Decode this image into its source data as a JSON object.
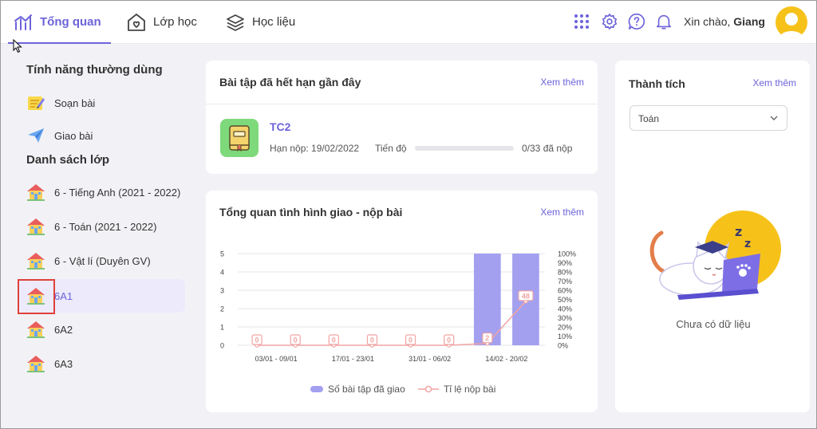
{
  "nav": {
    "tabs": [
      {
        "label": "Tổng quan",
        "icon": "chart-icon"
      },
      {
        "label": "Lớp học",
        "icon": "house-heart-icon"
      },
      {
        "label": "Học liệu",
        "icon": "layers-icon"
      }
    ],
    "greeting_prefix": "Xin chào, ",
    "greeting_name": "Giang"
  },
  "sidebar": {
    "features_heading": "Tính năng thường dùng",
    "features": [
      {
        "label": "Soạn bài",
        "icon": "notepad-icon"
      },
      {
        "label": "Giao bài",
        "icon": "paper-plane-icon"
      }
    ],
    "classes_heading": "Danh sách lớp",
    "classes": [
      {
        "label": "6 - Tiếng Anh (2021 - 2022)"
      },
      {
        "label": "6 - Toán (2021 - 2022)"
      },
      {
        "label": "6 - Vật lí (Duyên GV)"
      },
      {
        "label": "6A1",
        "active": true
      },
      {
        "label": "6A2"
      },
      {
        "label": "6A3"
      }
    ]
  },
  "expired": {
    "title": "Bài tập đã hết hạn gần đây",
    "see_more": "Xem thêm",
    "item": {
      "name": "TC2",
      "deadline": "Hạn nộp: 19/02/2022",
      "progress_label": "Tiến độ",
      "progress": 0,
      "count": "0/33 đã nộp"
    }
  },
  "overview": {
    "title": "Tổng quan tình hình giao - nộp bài",
    "see_more": "Xem thêm"
  },
  "chart_data": {
    "type": "bar",
    "categories": [
      "03/01 - 09/01",
      "",
      "17/01 - 23/01",
      "",
      "31/01 - 06/02",
      "",
      "14/02 - 20/02",
      ""
    ],
    "series": [
      {
        "name": "Số bài tập đã giao",
        "type": "bar",
        "values": [
          0,
          0,
          0,
          0,
          0,
          0,
          5,
          5
        ],
        "color": "#a3a0f0"
      },
      {
        "name": "Tỉ lệ nộp bài",
        "type": "line",
        "values": [
          0,
          0,
          0,
          0,
          0,
          0,
          2,
          48
        ],
        "color": "#f2a3a3"
      }
    ],
    "y_left_ticks": [
      "0",
      "1",
      "2",
      "3",
      "4",
      "5"
    ],
    "y_right_ticks": [
      "0%",
      "10%",
      "20%",
      "30%",
      "40%",
      "50%",
      "60%",
      "70%",
      "80%",
      "90%",
      "100%"
    ],
    "ylim_left": [
      0,
      5
    ],
    "ylim_right": [
      0,
      100
    ],
    "grid": true,
    "legend": "bottom"
  },
  "achievement": {
    "title": "Thành tích",
    "see_more": "Xem thêm",
    "subject": "Toán",
    "empty": "Chưa có dữ liệu"
  },
  "colors": {
    "accent": "#6c63d9",
    "bar": "#a3a0f0",
    "line": "#f2a3a3"
  }
}
